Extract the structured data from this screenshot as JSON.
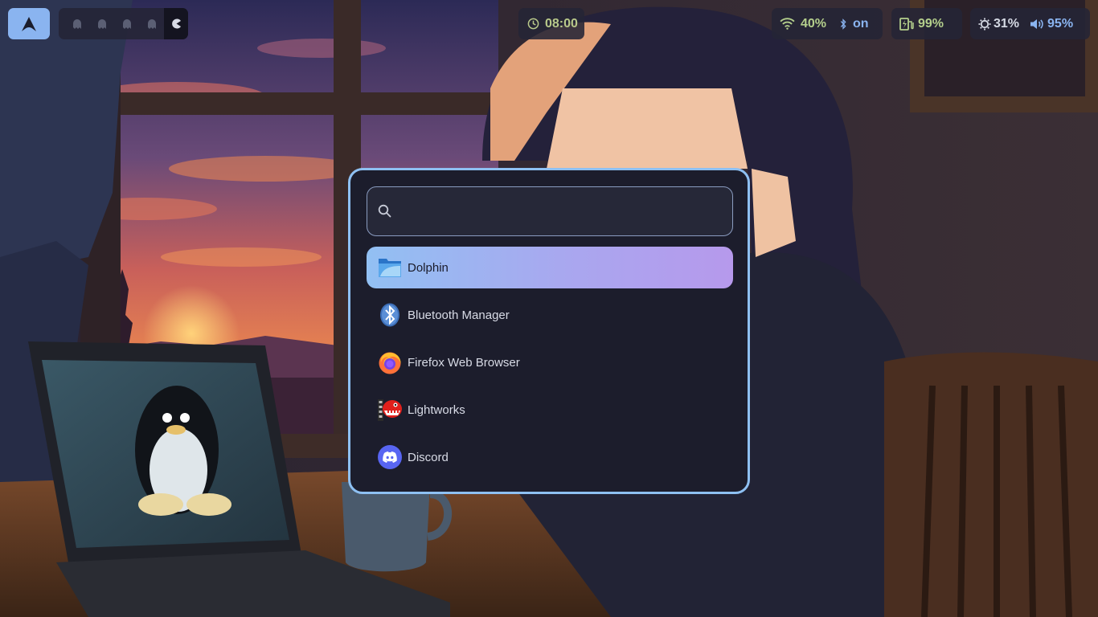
{
  "topbar": {
    "launcher_icon": "arch-logo-icon",
    "workspaces": [
      {
        "icon": "ghost-icon",
        "active": false
      },
      {
        "icon": "ghost-icon",
        "active": false
      },
      {
        "icon": "ghost-icon",
        "active": false
      },
      {
        "icon": "ghost-icon",
        "active": false
      },
      {
        "icon": "pacman-icon",
        "active": true
      }
    ],
    "clock": {
      "icon": "clock-icon",
      "time": "08:00"
    },
    "network": {
      "wifi_icon": "wifi-icon",
      "wifi": "40%",
      "bluetooth_icon": "bluetooth-icon",
      "bluetooth": "on"
    },
    "battery": {
      "icon": "battery-charging-icon",
      "level": "99%"
    },
    "brightness": {
      "icon": "sun-icon",
      "level": "31%"
    },
    "volume": {
      "icon": "volume-icon",
      "level": "95%"
    }
  },
  "launcher": {
    "search": {
      "icon": "search-icon",
      "placeholder": "",
      "value": ""
    },
    "apps": [
      {
        "name": "Dolphin",
        "icon": "dolphin-folder-icon",
        "selected": true
      },
      {
        "name": "Bluetooth Manager",
        "icon": "bluetooth-manager-icon",
        "selected": false
      },
      {
        "name": "Firefox Web Browser",
        "icon": "firefox-icon",
        "selected": false
      },
      {
        "name": "Lightworks",
        "icon": "lightworks-icon",
        "selected": false
      },
      {
        "name": "Discord",
        "icon": "discord-icon",
        "selected": false
      }
    ]
  },
  "colors": {
    "accent": "#8ec0f2",
    "selection_start": "#92c0f3",
    "selection_end": "#b699ec",
    "menu_bg": "#1c1d2c",
    "bar_green": "#b4cf8c",
    "bar_blue": "#8ab4f0"
  }
}
